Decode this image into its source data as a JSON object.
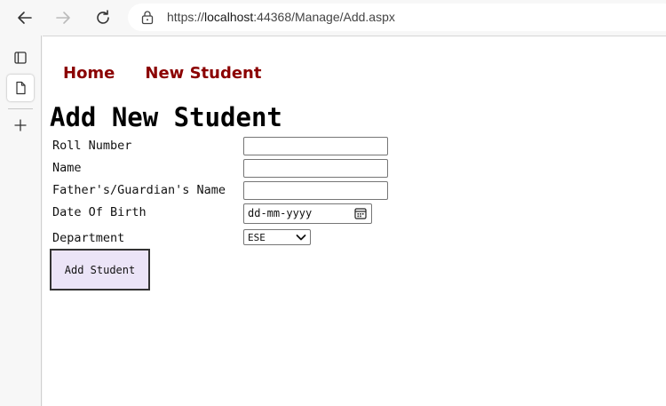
{
  "browser": {
    "url_prefix": "https://",
    "url_host": "localhost",
    "url_rest": ":44368/Manage/Add.aspx"
  },
  "menu": {
    "home": "Home",
    "new_student": "New Student"
  },
  "page": {
    "title": "Add New Student"
  },
  "form": {
    "roll_label": "Roll Number",
    "roll_value": "",
    "name_label": "Name",
    "name_value": "",
    "father_label": "Father's/Guardian's Name",
    "father_value": "",
    "dob_label": "Date Of Birth",
    "dob_placeholder": "dd-mm-yyyy",
    "dept_label": "Department",
    "dept_selected": "ESE",
    "submit_label": "Add Student"
  },
  "colors": {
    "menu_link": "#8b0000",
    "button_bg": "#ebe4f7"
  }
}
